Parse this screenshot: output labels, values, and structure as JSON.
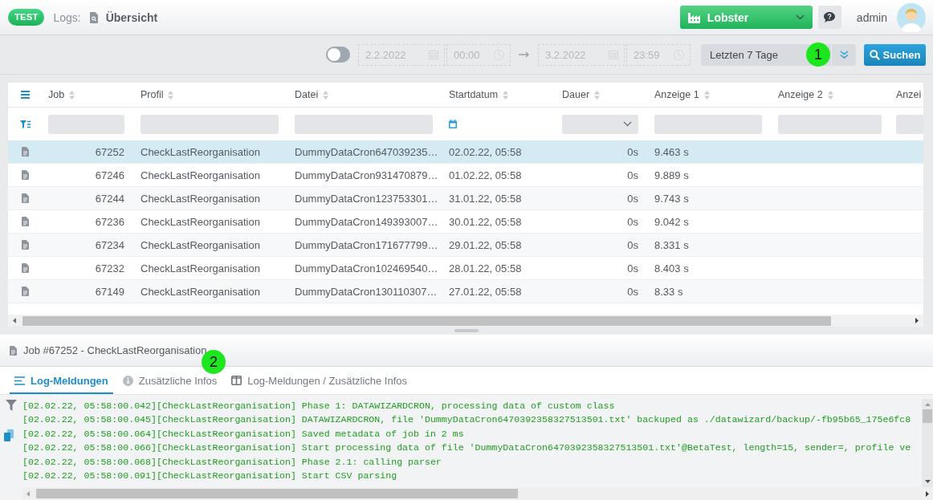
{
  "header": {
    "badge": "TEST",
    "section": "Logs:",
    "page": "Übersicht",
    "tenant": "Lobster",
    "user": "admin"
  },
  "filter_bar": {
    "range_enabled": false,
    "from": {
      "date": "2.2.2022",
      "time": "00:00"
    },
    "to": {
      "date": "3.2.2022",
      "time": "23:59"
    },
    "preset": "Letzten 7 Tage",
    "search_button": "Suchen"
  },
  "table": {
    "columns": [
      {
        "label": "Job",
        "sortable": true,
        "kind": "text"
      },
      {
        "label": "Profil",
        "sortable": true,
        "kind": "text"
      },
      {
        "label": "Datei",
        "sortable": true,
        "kind": "text"
      },
      {
        "label": "Startdatum",
        "sortable": true,
        "kind": "date"
      },
      {
        "label": "Dauer",
        "sortable": true,
        "kind": "select"
      },
      {
        "label": "Anzeige 1",
        "sortable": true,
        "kind": "text"
      },
      {
        "label": "Anzeige 2",
        "sortable": true,
        "kind": "text"
      },
      {
        "label": "Anzei",
        "sortable": false,
        "kind": "text"
      }
    ],
    "rows": [
      {
        "selected": true,
        "cells": [
          "67252",
          "CheckLastReorganisation",
          "DummyDataCron647039235…",
          "02.02.22, 05:58",
          "0s",
          "9.463 s"
        ]
      },
      {
        "selected": false,
        "cells": [
          "67246",
          "CheckLastReorganisation",
          "DummyDataCron931470879…",
          "01.02.22, 05:58",
          "0s",
          "9.889 s"
        ]
      },
      {
        "selected": false,
        "cells": [
          "67244",
          "CheckLastReorganisation",
          "DummyDataCron123753301…",
          "31.01.22, 05:58",
          "0s",
          "9.743 s"
        ]
      },
      {
        "selected": false,
        "cells": [
          "67236",
          "CheckLastReorganisation",
          "DummyDataCron149393007…",
          "30.01.22, 05:58",
          "0s",
          "9.042 s"
        ]
      },
      {
        "selected": false,
        "cells": [
          "67234",
          "CheckLastReorganisation",
          "DummyDataCron171677799…",
          "29.01.22, 05:58",
          "0s",
          "8.331 s"
        ]
      },
      {
        "selected": false,
        "cells": [
          "67232",
          "CheckLastReorganisation",
          "DummyDataCron102469540…",
          "28.01.22, 05:58",
          "0s",
          "8.403 s"
        ]
      },
      {
        "selected": false,
        "cells": [
          "67149",
          "CheckLastReorganisation",
          "DummyDataCron130110307…",
          "27.01.22, 05:58",
          "0s",
          "8.33 s"
        ]
      }
    ]
  },
  "job_panel": {
    "title": "Job #67252 - CheckLastReorganisation",
    "tabs": [
      {
        "label": "Log-Meldungen",
        "selected": true
      },
      {
        "label": "Zusätzliche Infos",
        "selected": false
      },
      {
        "label": "Log-Meldungen / Zusätzliche Infos",
        "selected": false
      }
    ],
    "log_lines": [
      "[02.02.22, 05:58:00.042][CheckLastReorganisation] Phase 1: DATAWIZARDCRON, processing data of custom class",
      "[02.02.22, 05:58:00.045][CheckLastReorganisation] DATAWIZARDCRON, file 'DummyDataCron6470392358327513501.txt' backuped as ./datawizard/backup/-fb95b65_175e6fc8",
      "[02.02.22, 05:58:00.064][CheckLastReorganisation] Saved metadata of job in 2 ms",
      "[02.02.22, 05:58:00.066][CheckLastReorganisation] Start processing data of file 'DummyDataCron6470392358327513501.txt'@BetaTest, length=15, sender=, profile ve",
      "[02.02.22, 05:58:00.068][CheckLastReorganisation] Phase 2.1: calling parser",
      "[02.02.22, 05:58:00.091][CheckLastReorganisation] Start CSV parsing"
    ]
  },
  "callouts": [
    "1",
    "2"
  ]
}
